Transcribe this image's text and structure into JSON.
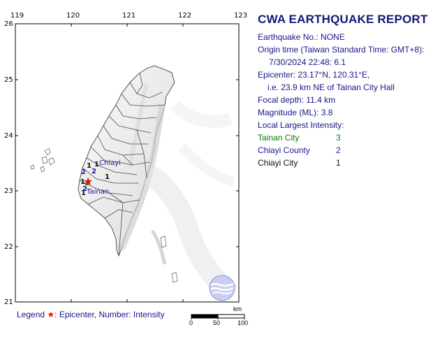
{
  "map": {
    "x_ticks": [
      "119",
      "120",
      "121",
      "122",
      "123"
    ],
    "y_ticks": [
      "26",
      "25",
      "24",
      "23",
      "22",
      "21"
    ],
    "epicenter_label": "Chiayi",
    "tainan_label": "Tainan",
    "intensity_markers": [
      {
        "value": "1",
        "place": "Chiayi City"
      },
      {
        "value": "1",
        "place": ""
      },
      {
        "value": "2",
        "place": "Chiayi County"
      },
      {
        "value": "2",
        "place": "Chiayi County"
      },
      {
        "value": "1",
        "place": ""
      },
      {
        "value": "1",
        "place": ""
      },
      {
        "value": "3",
        "place": "Tainan City"
      },
      {
        "value": "2",
        "place": ""
      },
      {
        "value": "1",
        "place": ""
      }
    ],
    "scale": {
      "unit": "km",
      "labels": [
        "0",
        "50",
        "100"
      ]
    },
    "colors": {
      "land": "#f3f3f3",
      "sea": "#ffffff",
      "border": "#4a4a4a",
      "star": "#e01414",
      "label": "#16168a"
    }
  },
  "report": {
    "title": "CWA EARTHQUAKE REPORT",
    "earthquake_no": "Earthquake No.: NONE",
    "origin_time_label": "Origin time (Taiwan Standard Time: GMT+8):",
    "origin_time_value": "7/30/2024 22:48: 6.1",
    "epicenter": "Epicenter: 23.17°N, 120.31°E,",
    "epicenter_relative": "i.e. 23.9 km NE of Tainan City Hall",
    "focal_depth": "Focal depth: 11.4 km",
    "magnitude": "Magnitude (ML): 3.8",
    "intensity_heading": "Local Largest Intensity:",
    "intensity_list": [
      {
        "place": "Tainan City",
        "value": "3",
        "color": "#0a7a0a"
      },
      {
        "place": "Chiayi County",
        "value": "2",
        "color": "#1a1aa0"
      },
      {
        "place": "Chiayi City",
        "value": "1",
        "color": "#111111"
      }
    ]
  },
  "legend": {
    "prefix": "Legend",
    "star_glyph": "★",
    "text": ": Epicenter, Number: Intensity"
  },
  "logo": {
    "name": "cwa-logo-icon"
  }
}
